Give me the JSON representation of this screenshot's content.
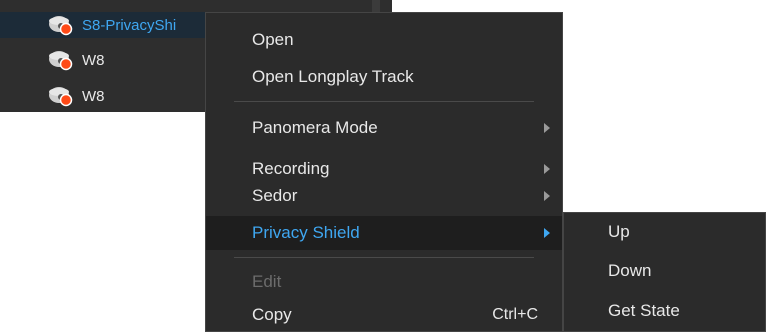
{
  "tree": {
    "items": [
      {
        "label": "S8-PrivacyShi",
        "selected": true,
        "icon": "camera-icon"
      },
      {
        "label": "W8",
        "selected": false,
        "icon": "camera-icon"
      },
      {
        "label": "W8",
        "selected": false,
        "icon": "camera-icon"
      }
    ]
  },
  "context_menu": {
    "items": [
      {
        "label": "Open"
      },
      {
        "label": "Open Longplay Track"
      },
      {
        "label": "Panomera Mode",
        "submenu": true
      },
      {
        "label": "Recording",
        "submenu": true
      },
      {
        "label": "Sedor",
        "submenu": true
      },
      {
        "label": "Privacy Shield",
        "submenu": true,
        "active": true
      },
      {
        "label": "Edit",
        "disabled": true
      },
      {
        "label": "Copy",
        "shortcut": "Ctrl+C"
      }
    ]
  },
  "privacy_shield_submenu": {
    "items": [
      {
        "label": "Up"
      },
      {
        "label": "Down"
      },
      {
        "label": "Get State"
      }
    ]
  },
  "colors": {
    "background": "#2b2b2b",
    "accent": "#3fa7f1",
    "text": "#e8e8e8",
    "disabled_text": "#6c6c6c",
    "status_dot": "#ff4a17"
  }
}
